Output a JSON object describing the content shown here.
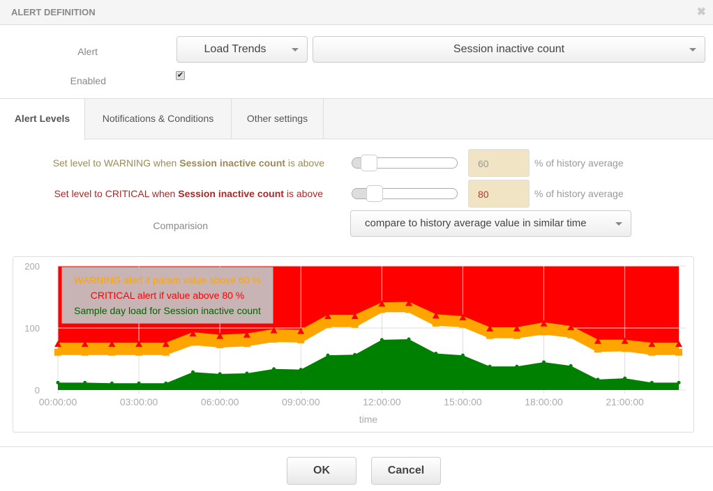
{
  "dialog": {
    "title": "ALERT DEFINITION",
    "close_icon": "close-icon"
  },
  "alert": {
    "label": "Alert",
    "type_value": "Load Trends",
    "param_value": "Session inactive count",
    "enabled_label": "Enabled",
    "enabled": true
  },
  "tabs": [
    {
      "label": "Alert Levels",
      "active": true
    },
    {
      "label": "Notifications & Conditions"
    },
    {
      "label": "Other settings"
    }
  ],
  "levels": {
    "warning": {
      "prefix": "Set level to WARNING when ",
      "param": "Session inactive count",
      "suffix": " is above",
      "value": "60",
      "unit": "% of history average",
      "color": "#9b8a5a"
    },
    "critical": {
      "prefix": "Set level to CRITICAL when ",
      "param": "Session inactive count",
      "suffix": " is above",
      "value": "80",
      "unit": "% of history average",
      "color": "#a52a2a"
    },
    "comparison_label": "Comparision",
    "comparison_value": "compare to history average value in similar time"
  },
  "chart_data": {
    "type": "area",
    "xlabel": "time",
    "ylim": [
      0,
      200
    ],
    "yticks": [
      "0",
      "100",
      "200"
    ],
    "xticks": [
      "00:00:00",
      "03:00:00",
      "06:00:00",
      "09:00:00",
      "12:00:00",
      "15:00:00",
      "18:00:00",
      "21:00:00"
    ],
    "x_hours": [
      0,
      1,
      2,
      3,
      4,
      5,
      6,
      7,
      8,
      9,
      10,
      11,
      12,
      13,
      14,
      15,
      16,
      17,
      18,
      19,
      20,
      21,
      22,
      23
    ],
    "series": [
      {
        "key": "sample",
        "color": "#008000",
        "values": [
          12,
          12,
          11,
          11,
          11,
          29,
          26,
          27,
          34,
          33,
          56,
          57,
          81,
          82,
          59,
          56,
          38,
          38,
          45,
          39,
          17,
          19,
          12,
          12
        ]
      },
      {
        "key": "warning",
        "color": "#ffa500",
        "values": [
          61,
          61,
          61,
          61,
          61,
          77,
          73,
          75,
          82,
          81,
          106,
          106,
          130,
          130,
          108,
          106,
          88,
          88,
          94,
          89,
          66,
          67,
          61,
          61
        ]
      },
      {
        "key": "critical",
        "color": "#ff0000",
        "values": [
          74,
          74,
          74,
          74,
          74,
          91,
          87,
          89,
          96,
          95,
          119,
          119,
          139,
          140,
          120,
          117,
          99,
          99,
          107,
          101,
          79,
          79,
          74,
          74
        ]
      }
    ],
    "legend": [
      {
        "text": "WARNING alert if param value above 60 %",
        "color": "#ffa500"
      },
      {
        "text": "CRITICAL alert if value above 80 %",
        "color": "#ff0000"
      },
      {
        "text": "Sample day load for Session inactive count",
        "color": "#006400"
      }
    ],
    "legend_placement": "top-left",
    "grid": true
  },
  "buttons": {
    "ok": "OK",
    "cancel": "Cancel"
  }
}
